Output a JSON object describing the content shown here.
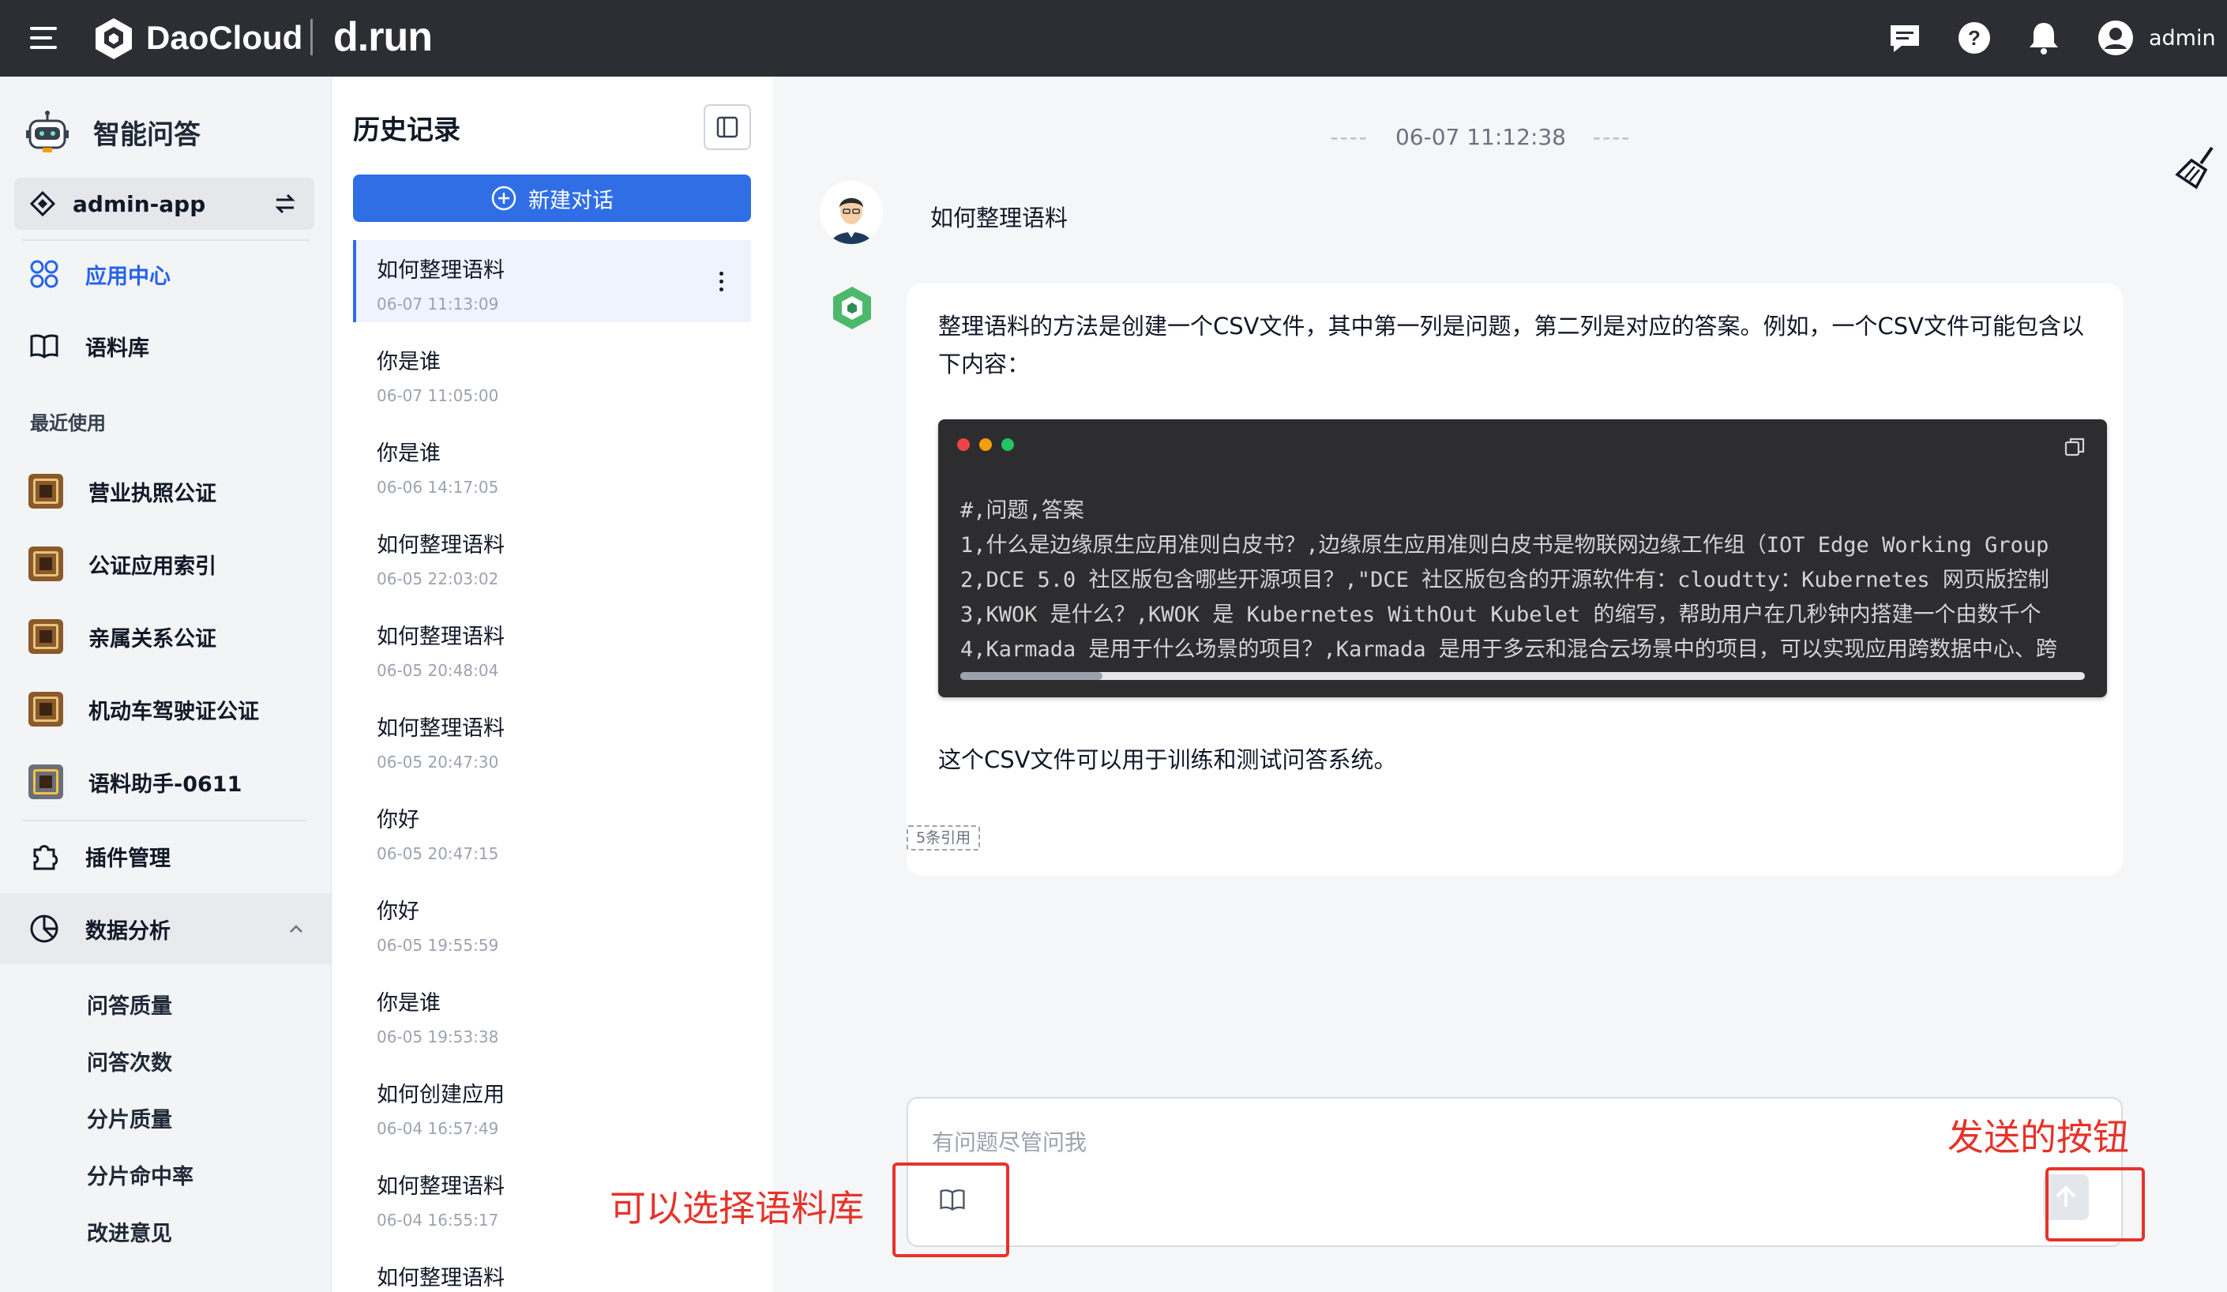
{
  "header": {
    "brand": "DaoCloud",
    "product": "d.run",
    "user": "admin",
    "icons": [
      "message-icon",
      "help-icon",
      "bell-icon",
      "user-avatar-icon"
    ]
  },
  "sidebar": {
    "title": "智能问答",
    "app": "admin-app",
    "items": [
      {
        "label": "应用中心",
        "icon": "apps-grid-icon",
        "active": true
      },
      {
        "label": "语料库",
        "icon": "book-icon",
        "active": false
      }
    ],
    "recent_title": "最近使用",
    "recent": [
      {
        "label": "营业执照公证"
      },
      {
        "label": "公证应用索引"
      },
      {
        "label": "亲属关系公证"
      },
      {
        "label": "机动车驾驶证公证"
      },
      {
        "label": "语料助手-0611"
      }
    ],
    "plugins": "插件管理",
    "analytics": "数据分析",
    "analytics_sub": [
      "问答质量",
      "问答次数",
      "分片质量",
      "分片命中率",
      "改进意见"
    ]
  },
  "history": {
    "title": "历史记录",
    "new_chat": "新建对话",
    "items": [
      {
        "title": "如何整理语料",
        "time": "06-07 11:13:09"
      },
      {
        "title": "你是谁",
        "time": "06-07 11:05:00"
      },
      {
        "title": "你是谁",
        "time": "06-06 14:17:05"
      },
      {
        "title": "如何整理语料",
        "time": "06-05 22:03:02"
      },
      {
        "title": "如何整理语料",
        "time": "06-05 20:48:04"
      },
      {
        "title": "如何整理语料",
        "time": "06-05 20:47:30"
      },
      {
        "title": "你好",
        "time": "06-05 20:47:15"
      },
      {
        "title": "你好",
        "time": "06-05 19:55:59"
      },
      {
        "title": "你是谁",
        "time": "06-05 19:53:38"
      },
      {
        "title": "如何创建应用",
        "time": "06-04 16:57:49"
      },
      {
        "title": "如何整理语料",
        "time": "06-04 16:55:17"
      },
      {
        "title": "如何整理语料",
        "time": ""
      }
    ]
  },
  "chat": {
    "timestamp": "06-07 11:12:38",
    "question": "如何整理语料",
    "answer_intro": "整理语料的方法是创建一个CSV文件，其中第一列是问题，第二列是对应的答案。例如，一个CSV文件可能包含以下内容：",
    "code_lines": [
      "#,问题,答案",
      "1,什么是边缘原生应用准则白皮书？,边缘原生应用准则白皮书是物联网边缘工作组（IOT Edge Working Group",
      "2,DCE 5.0 社区版包含哪些开源项目？,\"DCE 社区版包含的开源软件有：cloudtty：Kubernetes 网页版控制",
      "3,KWOK 是什么？,KWOK 是 Kubernetes WithOut Kubelet 的缩写，帮助用户在几秒钟内搭建一个由数千个",
      "4,Karmada 是用于什么场景的项目？,Karmada 是用于多云和混合云场景中的项目，可以实现应用跨数据中心、跨"
    ],
    "answer_outro": "这个CSV文件可以用于训练和测试问答系统。",
    "citations": "5条引用",
    "input_placeholder": "有问题尽管问我"
  },
  "annotations": {
    "knowledge": "可以选择语料库",
    "send": "发送的按钮"
  },
  "colors": {
    "topbar": "#2c2e33",
    "accent": "#2f6ee5",
    "annotation": "#e5332a"
  }
}
